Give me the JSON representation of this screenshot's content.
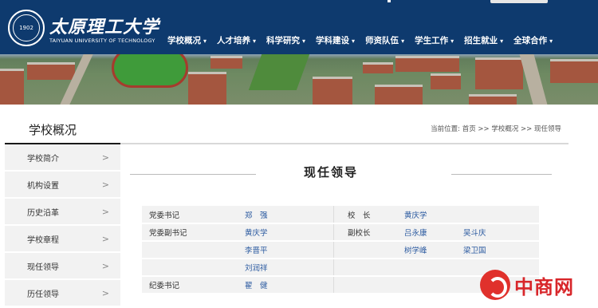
{
  "header": {
    "logo_cn": "太原理工大学",
    "logo_en": "TAIYUAN UNIVERSITY OF TECHNOLOGY",
    "seal_year": "1902",
    "nav": [
      "学校概况",
      "人才培养",
      "科学研究",
      "学科建设",
      "师资队伍",
      "学生工作",
      "招生就业",
      "全球合作"
    ],
    "caret": "▾"
  },
  "page": {
    "title": "学校概况",
    "breadcrumb": "当前位置: 首页 >> 学校概况 >> 现任领导"
  },
  "sidebar": {
    "items": [
      "学校简介",
      "机构设置",
      "历史沿革",
      "学校章程",
      "现任领导",
      "历任领导"
    ],
    "arrow": ">"
  },
  "content": {
    "heading": "现任领导",
    "rows": [
      {
        "role1": "党委书记",
        "names1": [
          "郑　强",
          ""
        ],
        "role2": "校　长",
        "names2": [
          "黄庆学",
          ""
        ]
      },
      {
        "role1": "党委副书记",
        "names1": [
          "黄庆学",
          ""
        ],
        "role2": "副校长",
        "names2": [
          "吕永康",
          "吴斗庆"
        ]
      },
      {
        "role1": "",
        "names1": [
          "李晋平",
          ""
        ],
        "role2": "",
        "names2": [
          "树学峰",
          "梁卫国"
        ]
      },
      {
        "role1": "",
        "names1": [
          "刘润祥",
          ""
        ],
        "role2": "",
        "names2": [
          "",
          ""
        ]
      },
      {
        "role1": "纪委书记",
        "names1": [
          "翟　健",
          ""
        ],
        "role2": "",
        "names2": [
          "",
          ""
        ]
      }
    ]
  },
  "watermark": {
    "text": "中商网"
  },
  "colors": {
    "header_bg": "#0e3a6e",
    "watermark_red": "#d8262a",
    "link_blue": "#2b5aa0"
  }
}
